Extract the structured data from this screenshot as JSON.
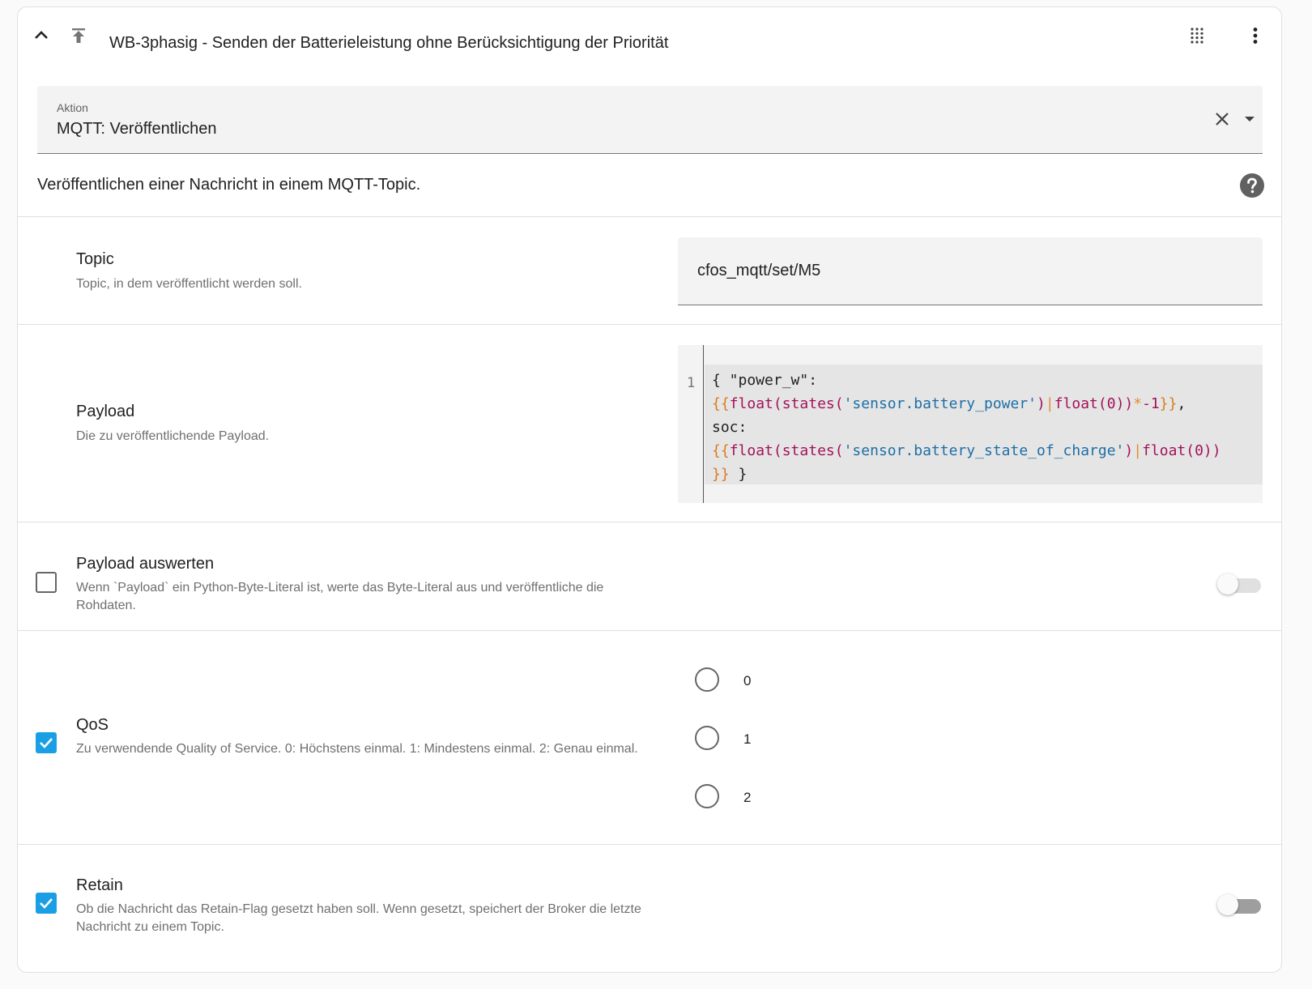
{
  "header": {
    "title": "WB-3phasig - Senden der Batterieleistung ohne Berücksichtigung der Priorität"
  },
  "aktion": {
    "label": "Aktion",
    "value": "MQTT: Veröffentlichen"
  },
  "description": "Veröffentlichen einer Nachricht in einem MQTT-Topic.",
  "topic": {
    "title": "Topic",
    "description": "Topic, in dem veröffentlicht werden soll.",
    "value": "cfos_mqtt/set/M5"
  },
  "payload": {
    "title": "Payload",
    "description": "Die zu veröffentlichende Payload.",
    "line_number": "1",
    "code": {
      "l1": "{ \"power_w\":",
      "l2_open": "{{",
      "l2_fn1": "float",
      "l2_p1": "(",
      "l2_fn2": "states",
      "l2_p2": "(",
      "l2_str": "'sensor.battery_power'",
      "l2_p3": ")",
      "l2_pipe": "|",
      "l2_fn3": "float",
      "l2_p4": "(0))",
      "l2_op": "*",
      "l2_num": "-1",
      "l2_close": "}}",
      "l2_comma": ",",
      "l3": "soc:",
      "l4_open": "{{",
      "l4_fn1": "float",
      "l4_p1": "(",
      "l4_fn2": "states",
      "l4_p2": "(",
      "l4_str": "'sensor.battery_state_of_charge'",
      "l4_p3": ")",
      "l4_pipe": "|",
      "l4_fn3": "float",
      "l4_p4": "(0))",
      "l5_close": "}}",
      "l5_rest": " }"
    }
  },
  "payload_auswerten": {
    "title": "Payload auswerten",
    "description": "Wenn `Payload` ein Python-Byte-Literal ist, werte das Byte-Literal aus und veröffentliche die Rohdaten.",
    "enabled": false,
    "toggle_on": false
  },
  "qos": {
    "title": "QoS",
    "description": "Zu verwendende Quality of Service. 0: Höchstens einmal. 1: Mindestens einmal. 2: Genau einmal.",
    "enabled": true,
    "options": [
      "0",
      "1",
      "2"
    ]
  },
  "retain": {
    "title": "Retain",
    "description": "Ob die Nachricht das Retain-Flag gesetzt haben soll. Wenn gesetzt, speichert der Broker die letzte Nachricht zu einem Topic.",
    "enabled": true,
    "toggle_on": false
  },
  "colors": {
    "accent": "#1a9fe5",
    "toggle_off_light": "#d0d0d0",
    "toggle_off_dark": "#9e9e9e"
  }
}
